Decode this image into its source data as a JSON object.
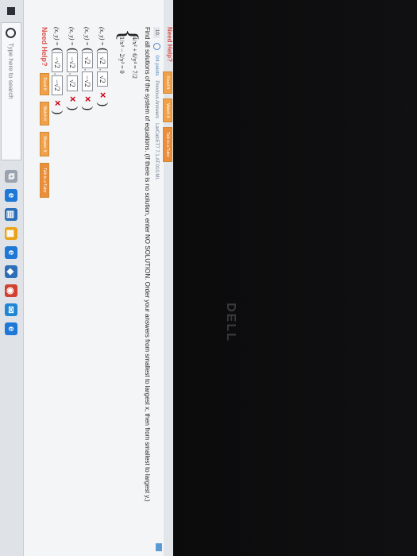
{
  "prev_help": {
    "label": "Need Help?",
    "buttons": [
      "Read It",
      "Watch It",
      "Talk to a Tutor"
    ]
  },
  "question": {
    "number": "10.",
    "points": "0/4 points",
    "status": "Previous Answers",
    "ref": "LarCalcET7 7.1.AT.010.MI.",
    "prompt": "Find all solutions of the system of equations. (If there is no solution, enter NO SOLUTION. Order your answers from smallest to largest x, then from smallest to largest y.)"
  },
  "system": {
    "eq1": "4/x² + 6/y⁴ = 7/2",
    "eq2": "1/x⁴ − 2/y² = 0"
  },
  "solutions": [
    {
      "label": "(x, y) =",
      "x": "√2",
      "y": "√2"
    },
    {
      "label": "(x, y) =",
      "x": "√2",
      "y": "−√2"
    },
    {
      "label": "(x, y) =",
      "x": "−√2",
      "y": "√2"
    },
    {
      "label": "(x, y) =",
      "x": "−√2",
      "y": "−√2"
    }
  ],
  "help": {
    "label": "Need Help?",
    "buttons": [
      "Read It",
      "Watch It",
      "Master It",
      "Talk to a Tutor"
    ]
  },
  "taskbar": {
    "search_placeholder": "Type here to search",
    "icons": [
      "task-view-icon",
      "edge-icon",
      "file-explorer-icon",
      "store-icon",
      "edge-icon",
      "dropbox-icon",
      "chrome-icon",
      "mail-icon",
      "edge-icon"
    ]
  },
  "monitor": {
    "brand": "DELL"
  },
  "colors": {
    "accent": "#4a86c5",
    "help": "#d9534f",
    "button": "#f0a048",
    "wrong": "#d0021b"
  }
}
